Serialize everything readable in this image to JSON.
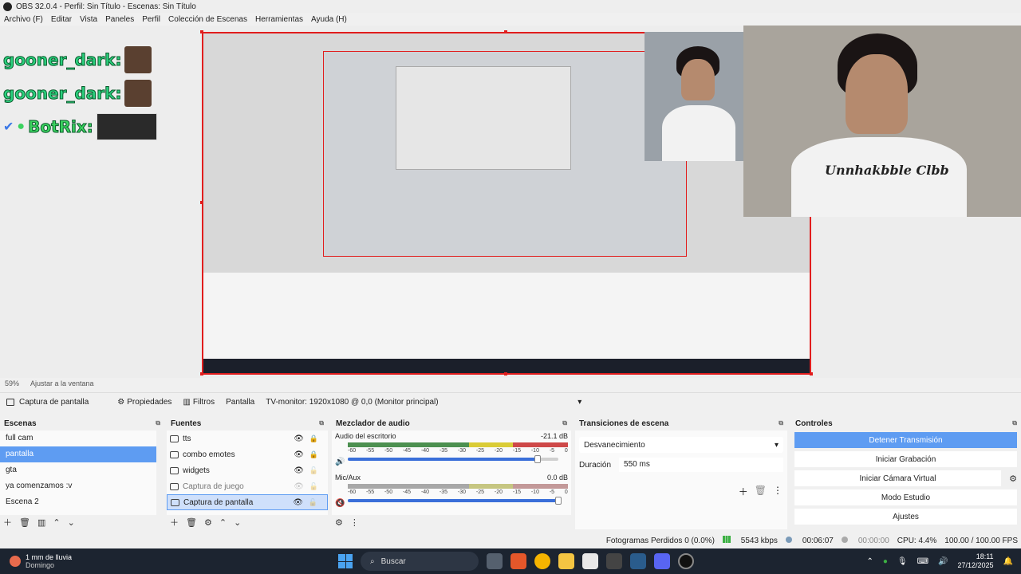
{
  "window": {
    "title": "OBS 32.0.4 - Perfil: Sin Título - Escenas: Sin Título"
  },
  "menu": [
    "Archivo (F)",
    "Editar",
    "Vista",
    "Paneles",
    "Perfil",
    "Colección de Escenas",
    "Herramientas",
    "Ayuda (H)"
  ],
  "chat": {
    "lines": [
      {
        "name": "gooner_dark:",
        "kind": "user"
      },
      {
        "name": "gooner_dark:",
        "kind": "user"
      },
      {
        "name": "BotRix:",
        "kind": "bot"
      }
    ]
  },
  "webcam": {
    "shirt_text": "Unnhakbble Clbb"
  },
  "zoom": {
    "level": "59%",
    "fit": "Ajustar a la ventana"
  },
  "source_toolbar": {
    "source_name": "Captura de pantalla",
    "properties": "Propiedades",
    "filters": "Filtros",
    "display_label": "Pantalla",
    "display_value": "TV-monitor: 1920x1080 @ 0,0 (Monitor principal)"
  },
  "scenes": {
    "title": "Escenas",
    "items": [
      "full cam",
      "pantalla",
      "gta",
      "ya comenzamos :v",
      "Escena 2"
    ],
    "selected_index": 1
  },
  "sources": {
    "title": "Fuentes",
    "items": [
      {
        "name": "tts",
        "visible": true,
        "locked": true
      },
      {
        "name": "combo emotes",
        "visible": true,
        "locked": true
      },
      {
        "name": "widgets",
        "visible": true,
        "locked": false
      },
      {
        "name": "Captura de juego",
        "visible": false,
        "locked": false
      },
      {
        "name": "Captura de pantalla",
        "visible": true,
        "locked": false
      }
    ],
    "selected_index": 4
  },
  "mixer": {
    "title": "Mezclador de audio",
    "channels": [
      {
        "name": "Audio del escritorio",
        "db": "-21.1 dB",
        "muted": false,
        "volume_fraction": 0.9
      },
      {
        "name": "Mic/Aux",
        "db": "0.0 dB",
        "muted": true,
        "volume_fraction": 1.0
      }
    ],
    "ticks": [
      "-60",
      "-55",
      "-50",
      "-45",
      "-40",
      "-35",
      "-30",
      "-25",
      "-20",
      "-15",
      "-10",
      "-5",
      "0"
    ]
  },
  "transitions": {
    "title": "Transiciones de escena",
    "selected": "Desvanecimiento",
    "duration_label": "Duración",
    "duration_value": "550 ms"
  },
  "controls": {
    "title": "Controles",
    "buttons": [
      "Detener Transmisión",
      "Iniciar Grabación",
      "Iniciar Cámara Virtual",
      "Modo Estudio",
      "Ajustes"
    ]
  },
  "status": {
    "dropped": "Fotogramas Perdidos 0 (0.0%)",
    "bitrate": "5543 kbps",
    "stream_time": "00:06:07",
    "rec_time": "00:00:00",
    "cpu": "CPU: 4.4%",
    "fps": "100.00 / 100.00 FPS"
  },
  "taskbar": {
    "weather_title": "1 mm de lluvia",
    "weather_sub": "Domingo",
    "search": "Buscar",
    "time": "18:11",
    "date": "27/12/2025"
  },
  "colors": {
    "accent": "#5e9cf2",
    "capture_border": "#e11d1d",
    "taskbar": "#1c2430"
  }
}
